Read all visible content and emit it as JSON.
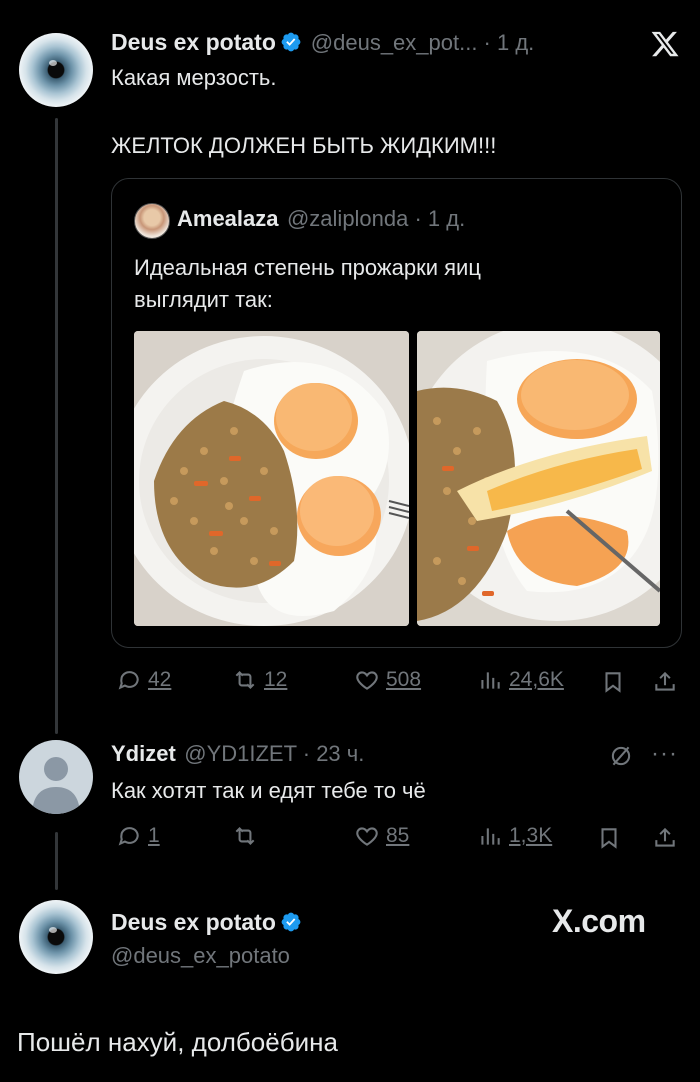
{
  "tweet1": {
    "name": "Deus ex potato",
    "handle_time": "@deus_ex_pot... · 1 д.",
    "line1": "Какая мерзость.",
    "line2": "ЖЕЛТОК ДОЛЖЕН БЫТЬ ЖИДКИМ!!!",
    "stats": {
      "replies": "42",
      "retweets": "12",
      "likes": "508",
      "views": "24,6K"
    }
  },
  "quote": {
    "name": "Amealaza",
    "handle_time": "@zaliplonda · 1 д.",
    "line1": "Идеальная степень прожарки яиц",
    "line2": "выглядит так:"
  },
  "reply": {
    "name": "Ydizet",
    "handle_time": "@YD1IZET · 23 ч.",
    "text": "Как хотят так и едят тебе то чё",
    "stats": {
      "replies": "1",
      "likes": "85",
      "views": "1,3K"
    }
  },
  "card": {
    "name": "Deus ex potato",
    "handle": "@deus_ex_potato",
    "brand": "X.com"
  },
  "caption": "Пошёл нахуй, долбоёбина",
  "colors": {
    "background": "#000000",
    "text": "#e7e9ea",
    "muted": "#71767b",
    "verified": "#1d9bf0",
    "border": "#2f3336"
  }
}
